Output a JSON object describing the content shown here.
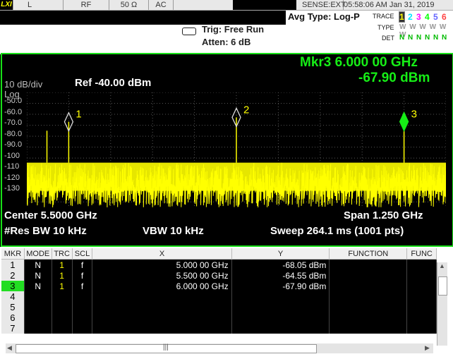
{
  "status_bar": {
    "logo": "LXI",
    "input": "L",
    "coupling_rf": "RF",
    "impedance": "50 Ω",
    "ac": "AC",
    "sense": "SENSE:EXT",
    "datetime": "05:58:06 AM Jan 31, 2019"
  },
  "acquisition": {
    "trigger": "Trig: Free Run",
    "atten": "Atten: 6 dB",
    "avg_type": "Avg Type: Log-P"
  },
  "trace_panel": {
    "trace_label": "TRACE",
    "type_label": "TYPE",
    "det_label": "DET",
    "numbers": [
      "1",
      "2",
      "3",
      "4",
      "5",
      "6"
    ],
    "type_values": "W W W W W W",
    "det_values": "N N N N N N",
    "colors": [
      "#ffff00",
      "#00e5ff",
      "#ff00ff",
      "#00ff00",
      "#6666ff",
      "#ff4444"
    ]
  },
  "display": {
    "scale": "10 dB/div",
    "scale_type": "Log",
    "ref_level": "Ref -40.00 dBm",
    "marker_readout_freq": "Mkr3 6.000 00 GHz",
    "marker_readout_amp": "-67.90 dBm",
    "center": "Center 5.5000 GHz",
    "span": "Span 1.250 GHz",
    "res_bw": "#Res BW 10 kHz",
    "vbw": "VBW 10 kHz",
    "sweep": "Sweep  264.1 ms (1001 pts)",
    "y_ticks": [
      "-50.0",
      "-60.0",
      "-70.0",
      "-80.0",
      "-90.0",
      "-100",
      "-110",
      "-120",
      "-130"
    ]
  },
  "chart_data": {
    "type": "line",
    "title": "",
    "xlabel": "",
    "ylabel": "",
    "x_range_ghz": [
      4.875,
      6.125
    ],
    "ylim": [
      -135,
      -40
    ],
    "noise_floor_dbm": [
      -135,
      -100
    ],
    "peaks": [
      {
        "x": 4.935,
        "y": -75
      },
      {
        "x": 5.0,
        "y": -68.05
      },
      {
        "x": 5.5,
        "y": -64.55
      },
      {
        "x": 6.0,
        "y": -67.9
      }
    ],
    "markers": [
      {
        "label": "1",
        "x": 5.0,
        "y": -68.05,
        "active": false
      },
      {
        "label": "2",
        "x": 5.5,
        "y": -64.55,
        "active": false
      },
      {
        "label": "3",
        "x": 6.0,
        "y": -67.9,
        "active": true
      }
    ],
    "trace_color": "#ffff00"
  },
  "marker_table": {
    "headers": [
      "MKR",
      "MODE",
      "TRC",
      "SCL",
      "X",
      "Y",
      "FUNCTION",
      "FUNC"
    ],
    "rows": [
      {
        "mkr": "1",
        "mode": "N",
        "trc": "1",
        "scl": "f",
        "x": "5.000 00 GHz",
        "y": "-68.05 dBm"
      },
      {
        "mkr": "2",
        "mode": "N",
        "trc": "1",
        "scl": "f",
        "x": "5.500 00 GHz",
        "y": "-64.55 dBm"
      },
      {
        "mkr": "3",
        "mode": "N",
        "trc": "1",
        "scl": "f",
        "x": "6.000 00 GHz",
        "y": "-67.90 dBm"
      },
      {
        "mkr": "4",
        "mode": "",
        "trc": "",
        "scl": "",
        "x": "",
        "y": ""
      },
      {
        "mkr": "5",
        "mode": "",
        "trc": "",
        "scl": "",
        "x": "",
        "y": ""
      },
      {
        "mkr": "6",
        "mode": "",
        "trc": "",
        "scl": "",
        "x": "",
        "y": ""
      },
      {
        "mkr": "7",
        "mode": "",
        "trc": "",
        "scl": "",
        "x": "",
        "y": ""
      }
    ],
    "selected_row": 2
  }
}
